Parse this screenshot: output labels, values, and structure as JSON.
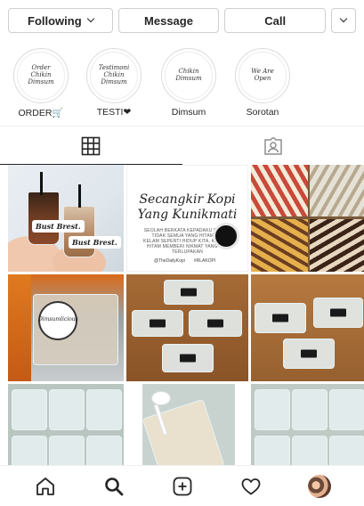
{
  "actions": {
    "following": "Following",
    "message": "Message",
    "call": "Call"
  },
  "highlights": [
    {
      "label": "ORDER🛒",
      "cover_text": "Order Chikin Dimsum"
    },
    {
      "label": "TESTI❤",
      "cover_text": "Testimoni Chikin Dimsum"
    },
    {
      "label": "Dimsum",
      "cover_text": "Chikin Dimsum"
    },
    {
      "label": "Sorotan",
      "cover_text": "We Are Open"
    }
  ],
  "posts": {
    "cup_label_1": "Bust Brest.",
    "cup_label_2": "Bust Brest.",
    "poster_title_1": "Secangkir Kopi",
    "poster_title_2": "Yang Kunikmati",
    "poster_sub": "SEOLAH BERKATA KEPADAKU BAHWA TIDAK SEMUA YANG HITAM ITU KELAM SEPERTI HIDUP KITA, KADANG HITAM MEMBERI NIKMAT YANG TAK TERLUPAKAN",
    "poster_foot_1": "@TheDailyKopi",
    "poster_foot_2": "#RLAKOPI",
    "pack_brand": "Dimsumlicious"
  },
  "colors": {
    "text": "#262626",
    "border": "#dbdbdb",
    "icon": "#262626",
    "inactive_icon": "#8e8e8e"
  },
  "icons": {
    "tab_grid": "grid-icon",
    "tab_tagged": "tagged-icon",
    "nav": [
      "home-icon",
      "search-icon",
      "add-post-icon",
      "heart-icon",
      "profile-avatar"
    ]
  }
}
